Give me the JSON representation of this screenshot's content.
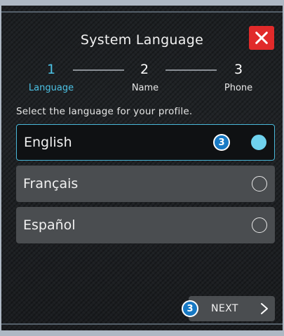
{
  "header": {
    "title": "System Language",
    "close_icon": "close-icon"
  },
  "steps": [
    {
      "number": "1",
      "label": "Language",
      "active": true
    },
    {
      "number": "2",
      "label": "Name",
      "active": false
    },
    {
      "number": "3",
      "label": "Phone",
      "active": false
    }
  ],
  "prompt": "Select the language for your profile.",
  "options": [
    {
      "label": "English",
      "selected": true
    },
    {
      "label": "Français",
      "selected": false
    },
    {
      "label": "Español",
      "selected": false
    }
  ],
  "badges": {
    "english": "3",
    "next": "3"
  },
  "footer": {
    "next_label": "NEXT",
    "next_icon": "chevron-right-icon"
  },
  "colors": {
    "accent": "#4cc3e6",
    "close_bg": "#e12a2a",
    "badge_bg": "#1779c4"
  }
}
